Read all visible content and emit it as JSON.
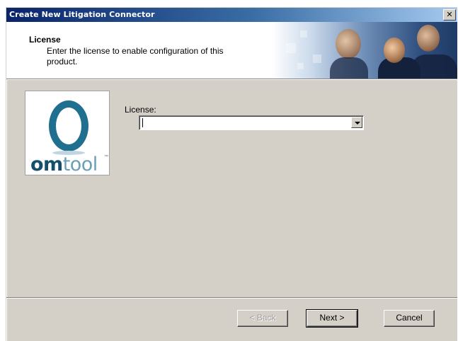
{
  "window": {
    "title": "Create New Litigation Connector",
    "close_glyph": "✕"
  },
  "header": {
    "title": "License",
    "description": "Enter the license to enable configuration of this product."
  },
  "logo": {
    "brand_part1": "om",
    "brand_part2": "tool",
    "trademark": "™",
    "colors": {
      "primary": "#13506b",
      "secondary": "#6a9fb5"
    }
  },
  "form": {
    "license_label": "License:",
    "license_value": ""
  },
  "buttons": {
    "back": "< Back",
    "next": "Next >",
    "cancel": "Cancel"
  },
  "icons": {
    "close": "close-icon",
    "dropdown": "chevron-down-icon"
  },
  "colors": {
    "titlebar_start": "#0a246a",
    "titlebar_end": "#a6caf0",
    "dialog_bg": "#d4d0c8"
  }
}
